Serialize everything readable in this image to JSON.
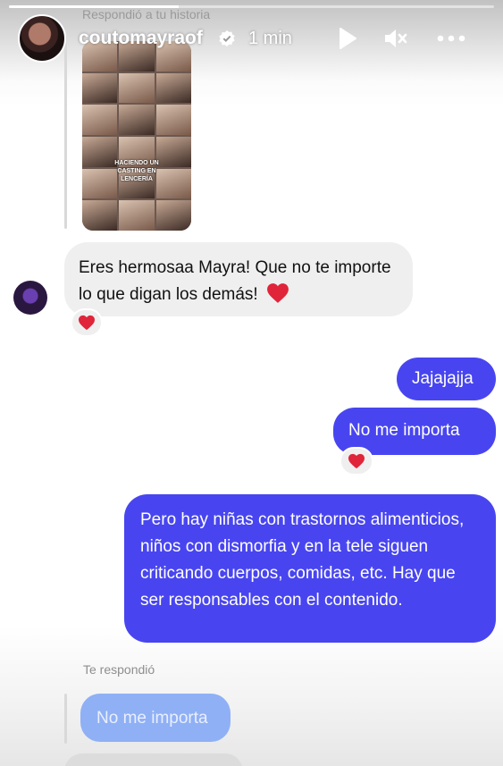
{
  "story": {
    "username": "coutomayraof",
    "time": "1 min",
    "progress": 0.35,
    "controls": [
      "play-icon",
      "mute-icon",
      "more-icon"
    ]
  },
  "thread": {
    "reply_label": "Respondió a tu historia",
    "story_caption": "HACIENDO UN CASTING EN LENCERÍA",
    "incoming_message": "Eres hermosaa Mayra! Que no te importe lo que digan los demás!",
    "outgoing_1": "Jajajajja",
    "outgoing_2": "No me importa",
    "outgoing_3": "Pero hay niñas con trastornos alimenticios, niños con dismorfia y en la tele siguen criticando cuerpos, comidas, etc. Hay que ser responsables con el contenido.",
    "replied_label": "Te respondió",
    "quoted_message": "No me importa"
  },
  "colors": {
    "outgoing_bubble": "#4845f0",
    "incoming_bubble": "#efefef",
    "heart": "#e0243a"
  }
}
